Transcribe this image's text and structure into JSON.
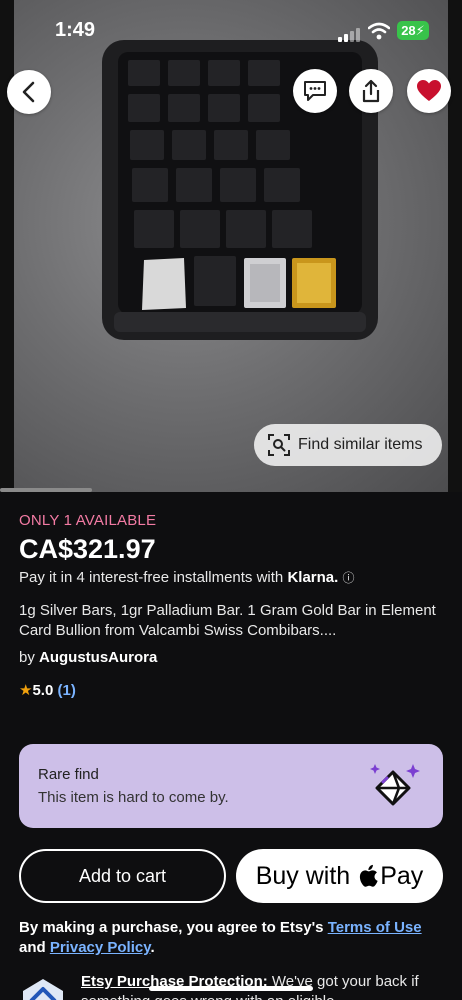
{
  "status_bar": {
    "time": "1:49",
    "battery": "28"
  },
  "header": {
    "back_icon": "chevron-left-icon",
    "message_icon": "message-icon",
    "share_icon": "share-icon",
    "favorite_icon": "heart-icon"
  },
  "hero": {
    "find_similar_label": "Find similar items"
  },
  "listing": {
    "availability": "ONLY 1 AVAILABLE",
    "price": "CA$321.97",
    "installments_text": "Pay it in 4 interest-free installments with",
    "installments_brand": "Klarna.",
    "title": "1g Silver Bars, 1gr Palladium Bar. 1 Gram Gold Bar in Element Card Bullion from Valcambi Swiss Combibars....",
    "seller_prefix": "by",
    "seller_name": "AugustusAurora",
    "rating": "5.0",
    "review_count": "(1)"
  },
  "rare_find": {
    "heading": "Rare find",
    "subtext": "This item is hard to come by."
  },
  "actions": {
    "add_to_cart": "Add to cart",
    "buy_with": "Buy with",
    "pay": "Pay"
  },
  "legal": {
    "prefix": "By making a purchase, you agree to Etsy's",
    "terms": "Terms of Use",
    "and": "and",
    "privacy": "Privacy Policy",
    "suffix": "."
  },
  "protection": {
    "title": "Etsy Purchase Protection:",
    "text": "We've got your back if something goes wrong with an eligible"
  },
  "colors": {
    "accent_pink": "#f37ba4",
    "link_blue": "#7ab3ff",
    "rare_bg": "#cdbfe8",
    "heart": "#c8102e"
  }
}
